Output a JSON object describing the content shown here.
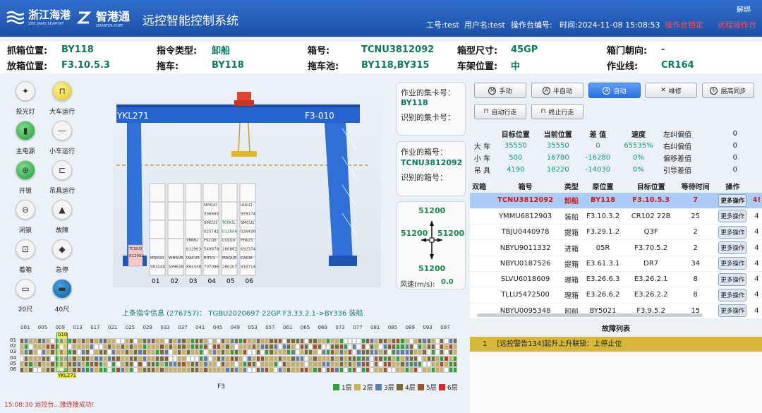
{
  "header": {
    "logo1": "浙江海港",
    "logo1_sub": "ZHE JIANG SEAPORT",
    "logo2": "智港通",
    "logo2_sub": "SMARTER PORT",
    "title": "远控智能控制系统",
    "work_no": "工号:test",
    "user": "用户名:test",
    "console": "操作台编号:",
    "time": "时间:2024-11-08 15:08:53",
    "warn1": "操作台锁定",
    "warn2": "远程操作台",
    "unlock": "解绑"
  },
  "info": {
    "pick_lbl": "抓箱位置:",
    "pick_val": "BY118",
    "type_lbl": "指令类型:",
    "type_val": "卸船",
    "box_lbl": "箱号:",
    "box_val": "TCNU3812092",
    "size_lbl": "箱型尺寸:",
    "size_val": "45GP",
    "door_lbl": "箱门朝向:",
    "door_val": "-",
    "place_lbl": "放箱位置:",
    "place_val": "F3.10.5.3",
    "truck_lbl": "拖车:",
    "truck_val": "BY118",
    "pool_lbl": "拖车池:",
    "pool_val": "BY118,BY315",
    "rack_lbl": "车架位置:",
    "rack_val": "中",
    "line_lbl": "作业线:",
    "line_val": "CR164"
  },
  "icons": [
    {
      "label": "投光灯",
      "name": "floodlight-icon"
    },
    {
      "label": "大车运行",
      "name": "gantry-run-icon"
    },
    {
      "label": "主电源",
      "name": "main-power-icon"
    },
    {
      "label": "小车运行",
      "name": "trolley-run-icon"
    },
    {
      "label": "开锁",
      "name": "unlock-icon"
    },
    {
      "label": "吊具运行",
      "name": "spreader-run-icon"
    },
    {
      "label": "闭锁",
      "name": "lock-icon"
    },
    {
      "label": "故障",
      "name": "fault-icon"
    },
    {
      "label": "着箱",
      "name": "landed-icon"
    },
    {
      "label": "急停",
      "name": "emergency-stop-icon"
    },
    {
      "label": "20尺",
      "name": "20ft-icon"
    },
    {
      "label": "40尺",
      "name": "40ft-icon"
    }
  ],
  "crane": {
    "left_label": "YKL271",
    "right_label": "F3-010",
    "bays": [
      "01",
      "02",
      "03",
      "04",
      "05",
      "06"
    ],
    "stack_texts": [
      {
        "bay": 0,
        "texts": [
          "TCNU3",
          "812092"
        ]
      },
      {
        "bay": 1,
        "texts": [
          "MSKU0",
          "983240"
        ]
      },
      {
        "bay": 2,
        "texts": [
          "WHSU5",
          "599638"
        ]
      },
      {
        "bay": 3,
        "texts": [
          "YMMU",
          "812903",
          "UACU5",
          "891338"
        ]
      },
      {
        "bay": 4,
        "texts": [
          "NYKU0",
          "336695",
          "SMCU1",
          "025742",
          "FSCU8",
          "549678",
          "EITU1",
          "707096"
        ]
      },
      {
        "bay": 5,
        "texts": [
          "TCNU1",
          "012688",
          "CULU0",
          "280862",
          "MAGU5",
          "280207"
        ]
      },
      {
        "bay": 6,
        "texts": [
          "IAAU1",
          "939174",
          "SMCU1",
          "026430",
          "FFAU3",
          "692374",
          "CAIU6",
          "918714"
        ]
      }
    ],
    "last_instr": "上条指令信息 (276757)： TGBU2020697 22GP F3.33.2.1->BY336 装船"
  },
  "side": {
    "truck_t": "作业的集卡号：",
    "truck_v": "BY118",
    "truck_id_t": "识别的集卡号：",
    "box_t": "作业的箱号：",
    "box_v": "TCNU3812092",
    "box_id_t": "识别的箱号：",
    "wind_top": "51200",
    "wind_left": "51200",
    "wind_right": "51200",
    "wind_bottom": "51200",
    "wind_t": "风速(m/s):",
    "wind_v": "0.0"
  },
  "modes": {
    "manual": "手动",
    "semi": "半自动",
    "auto": "自动",
    "repair": "维修",
    "sync": "层高同步",
    "autogo": "自动行走",
    "stopgo": "终止行走"
  },
  "pos_table": {
    "headers": [
      "",
      "目标位置",
      "当前位置",
      "差 值",
      "速度"
    ],
    "rows": [
      [
        "大 车",
        "35550",
        "35550",
        "0",
        "65535%"
      ],
      [
        "小 车",
        "500",
        "16780",
        "-16280",
        "0%"
      ],
      [
        "吊 具",
        "4190",
        "18220",
        "-14030",
        "0%"
      ]
    ]
  },
  "dev_table": [
    [
      "左纠偏值",
      "0"
    ],
    [
      "右纠偏值",
      "0"
    ],
    [
      "偏移差值",
      "0"
    ],
    [
      "引导差值",
      "0"
    ]
  ],
  "task_table": {
    "headers": [
      "双箱",
      "箱号",
      "类型",
      "原位置",
      "目标位置",
      "等待时间",
      "操作",
      ""
    ],
    "more": "更多操作",
    "rows": [
      [
        "",
        "TCNU3812092",
        "卸船",
        "BY118",
        "F3.10.5.3",
        "7",
        "4!"
      ],
      [
        "",
        "YMMU6812903",
        "装船",
        "F3.10.3.2",
        "CR102 22B",
        "25",
        "4"
      ],
      [
        "",
        "TBJU0440978",
        "提箱",
        "F3.29.1.2",
        "Q3F",
        "2",
        "4"
      ],
      [
        "",
        "NBYU9011332",
        "进箱",
        "05R",
        "F3.70.5.2",
        "2",
        "4"
      ],
      [
        "",
        "NBYU0187526",
        "提箱",
        "E3.61.3.1",
        "DR7",
        "34",
        "4"
      ],
      [
        "",
        "SLVU6018609",
        "理箱",
        "E3.26.6.3",
        "E3.26.2.1",
        "8",
        "4"
      ],
      [
        "",
        "TLLU5472500",
        "理箱",
        "E3.26.6.2",
        "E3.26.2.2",
        "8",
        "4"
      ],
      [
        "",
        "NBYU0095348",
        "卸船",
        "BY5021",
        "F3.9.5.2",
        "15",
        "4"
      ]
    ]
  },
  "fault": {
    "title": "故障列表",
    "row_no": "1",
    "row_text": "[远控警告134]起升上升联锁：上停止位"
  },
  "yard": {
    "cols": [
      "001",
      "005",
      "009",
      "013",
      "017",
      "021",
      "025",
      "029",
      "033",
      "037",
      "041",
      "045",
      "049",
      "053",
      "057",
      "061",
      "065",
      "069",
      "073",
      "077",
      "081",
      "085",
      "089",
      "093",
      "097"
    ],
    "rows": [
      "01",
      "02",
      "03",
      "04",
      "05",
      "06"
    ],
    "block": "F3",
    "highlight_bay": "010",
    "crane_tag": "YKL271",
    "legend": [
      "1层",
      "2层",
      "3层",
      "4层",
      "5层",
      "6层"
    ],
    "legend_colors": [
      "#2aa33a",
      "#c9b25a",
      "#5d7fa8",
      "#7a6a35",
      "#a0522d",
      "#d42a2a"
    ]
  },
  "status": "15:08:30 远控台...接连接成功!"
}
